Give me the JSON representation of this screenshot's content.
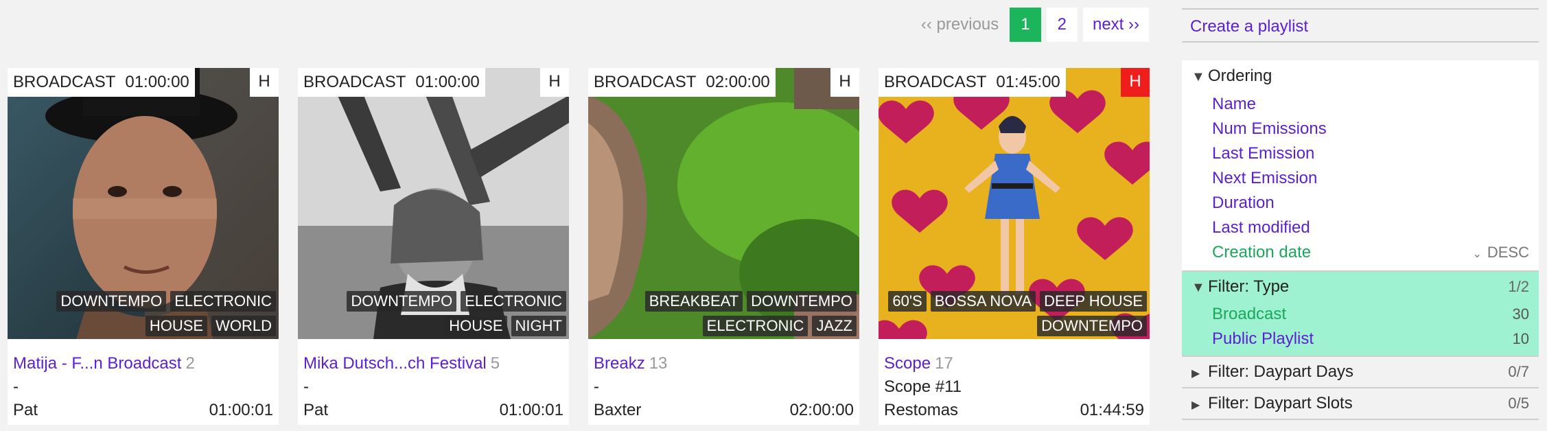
{
  "pagination": {
    "previous": "‹‹ previous",
    "pages": [
      "1",
      "2"
    ],
    "active_page": "1",
    "next": "next ››"
  },
  "cards": [
    {
      "type": "BROADCAST",
      "duration": "01:00:00",
      "flag": "H",
      "flag_color": "#ffffff",
      "tags": [
        "DOWNTEMPO",
        "ELECTRONIC",
        "HOUSE",
        "WORLD"
      ],
      "title": "Matija - F...n Broadcast",
      "count": "2",
      "subtitle": "-",
      "author": "Pat",
      "length": "01:00:01"
    },
    {
      "type": "BROADCAST",
      "duration": "01:00:00",
      "flag": "H",
      "flag_color": "#ffffff",
      "tags": [
        "DOWNTEMPO",
        "ELECTRONIC",
        "HOUSE",
        "NIGHT"
      ],
      "title": "Mika Dutsch...ch Festival",
      "count": "5",
      "subtitle": "-",
      "author": "Pat",
      "length": "01:00:01"
    },
    {
      "type": "BROADCAST",
      "duration": "02:00:00",
      "flag": "H",
      "flag_color": "#ffffff",
      "tags": [
        "BREAKBEAT",
        "DOWNTEMPO",
        "ELECTRONIC",
        "JAZZ"
      ],
      "title": "Breakz",
      "count": "13",
      "subtitle": "-",
      "author": "Baxter",
      "length": "02:00:00"
    },
    {
      "type": "BROADCAST",
      "duration": "01:45:00",
      "flag": "H",
      "flag_color": "#f01d1d",
      "tags": [
        "60'S",
        "BOSSA NOVA",
        "DEEP HOUSE",
        "DOWNTEMPO"
      ],
      "title": "Scope",
      "count": "17",
      "subtitle": "Scope #11",
      "author": "Restomas",
      "length": "01:44:59"
    }
  ],
  "sidebar": {
    "create_playlist": "Create a playlist",
    "ordering": {
      "label": "Ordering",
      "options": [
        "Name",
        "Num Emissions",
        "Last Emission",
        "Next Emission",
        "Duration",
        "Last modified",
        "Creation date"
      ],
      "selected": "Creation date",
      "direction": "DESC"
    },
    "filter_type": {
      "label": "Filter: Type",
      "count": "1/2",
      "options": [
        {
          "label": "Broadcast",
          "num": "30",
          "selected": true
        },
        {
          "label": "Public Playlist",
          "num": "10",
          "selected": false
        }
      ]
    },
    "filter_daypart_days": {
      "label": "Filter: Daypart Days",
      "count": "0/7"
    },
    "filter_daypart_slots": {
      "label": "Filter: Daypart Slots",
      "count": "0/5"
    }
  },
  "colors": {
    "link": "#5b1fd1",
    "active": "#1cb55c",
    "filter_bg": "#9ff2d1",
    "flag_red": "#f01d1d"
  }
}
